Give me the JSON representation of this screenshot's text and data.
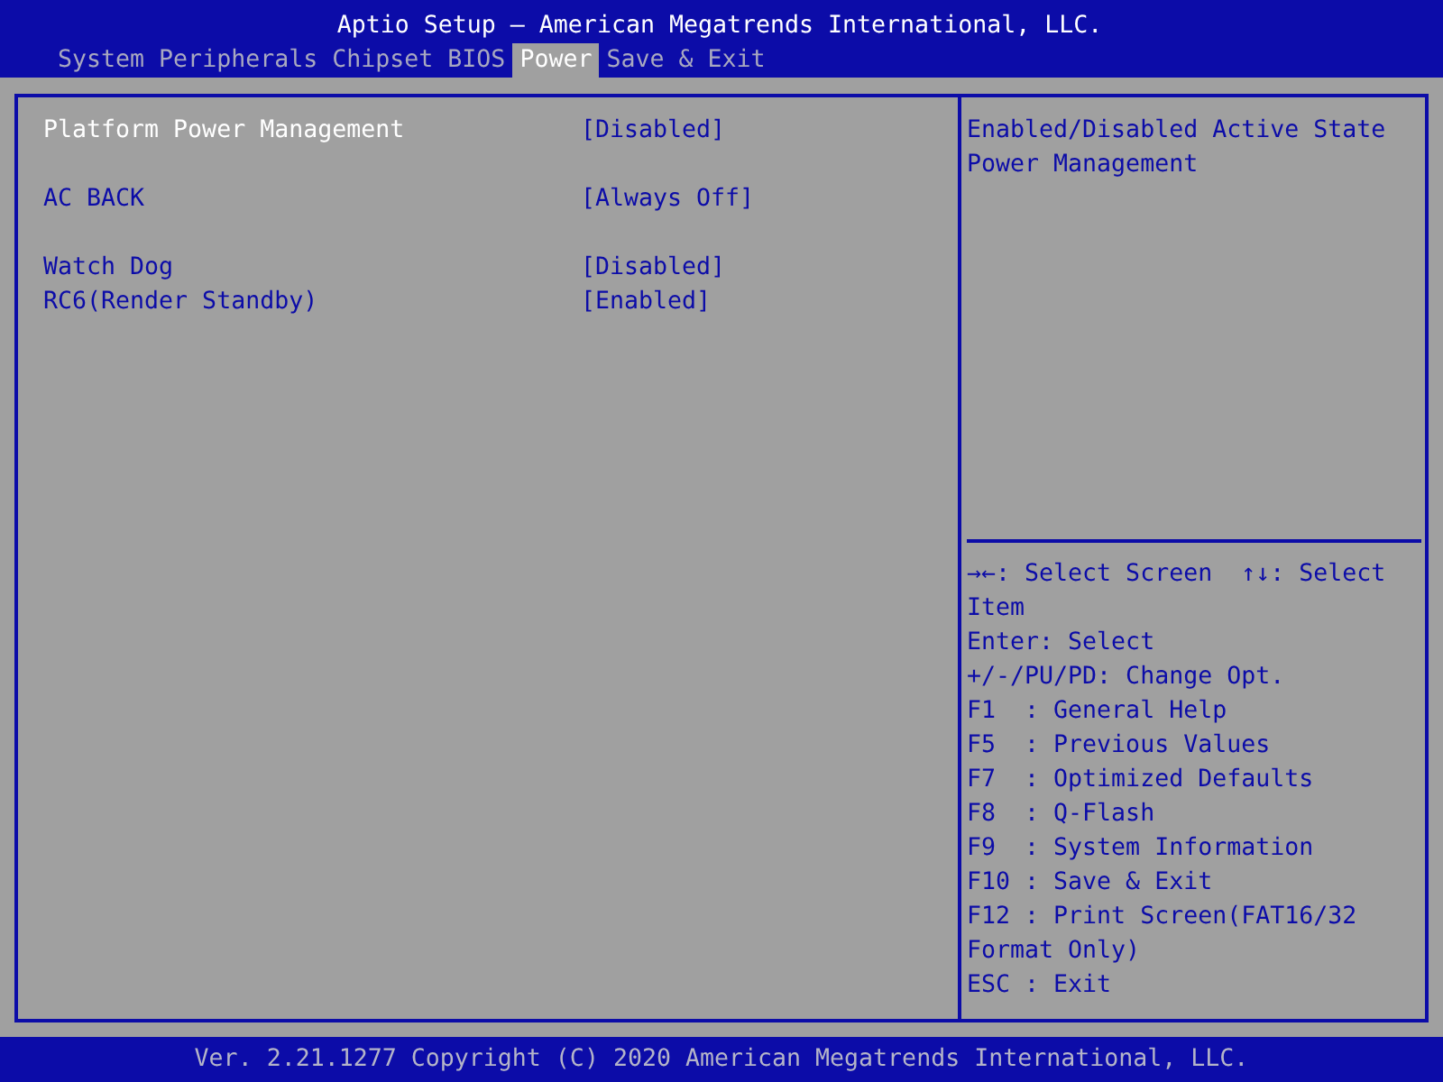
{
  "window": {
    "title": "Aptio Setup – American Megatrends International, LLC."
  },
  "tabs": [
    {
      "label": "System",
      "selected": false
    },
    {
      "label": "Peripherals",
      "selected": false
    },
    {
      "label": "Chipset",
      "selected": false
    },
    {
      "label": "BIOS",
      "selected": false
    },
    {
      "label": "Power",
      "selected": true
    },
    {
      "label": "Save & Exit",
      "selected": false
    }
  ],
  "settings": {
    "groups": [
      [
        {
          "label": "Platform Power Management",
          "value": "[Disabled]",
          "selected": true
        }
      ],
      [
        {
          "label": "AC BACK",
          "value": "[Always Off]",
          "selected": false
        }
      ],
      [
        {
          "label": "Watch Dog",
          "value": "[Disabled]",
          "selected": false
        },
        {
          "label": "RC6(Render Standby)",
          "value": "[Enabled]",
          "selected": false
        }
      ]
    ]
  },
  "help": {
    "description": "Enabled/Disabled Active State Power Management",
    "keys": [
      "→←: Select Screen  ↑↓: Select Item",
      "Enter: Select",
      "+/-/PU/PD: Change Opt.",
      "F1  : General Help",
      "F5  : Previous Values",
      "F7  : Optimized Defaults",
      "F8  : Q-Flash",
      "F9  : System Information",
      "F10 : Save & Exit",
      "F12 : Print Screen(FAT16/32 Format Only)",
      "ESC : Exit"
    ]
  },
  "status_bar": {
    "text": "Ver. 2.21.1277 Copyright (C) 2020 American Megatrends International, LLC."
  }
}
